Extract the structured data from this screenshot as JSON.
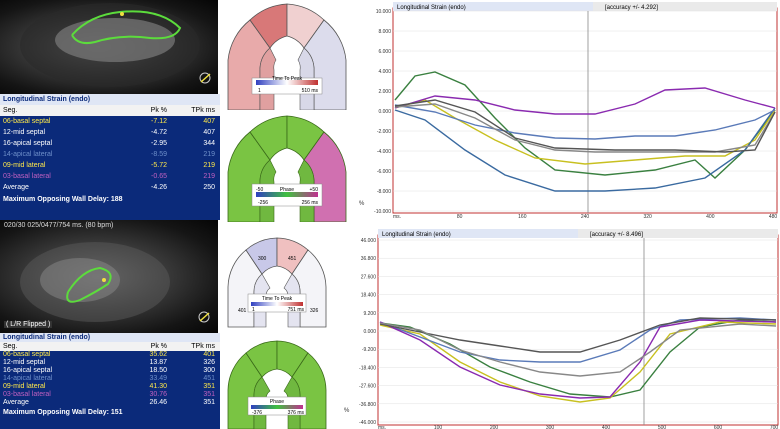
{
  "top": {
    "table": {
      "title": "Longitudinal Strain (endo)",
      "headers": [
        "Seg.",
        "Pk %",
        "TPk ms"
      ],
      "rows": [
        {
          "seg": "06-basal septal",
          "pk": "-7.12",
          "tpk": "407",
          "color": "#ffe94a"
        },
        {
          "seg": "12-mid septal",
          "pk": "-4.72",
          "tpk": "407",
          "color": "#ffffff"
        },
        {
          "seg": "16-apical septal",
          "pk": "-2.95",
          "tpk": "344",
          "color": "#ffffff"
        },
        {
          "seg": "14-apical lateral",
          "pk": "-8.59",
          "tpk": "219",
          "color": "#6e8fc9"
        },
        {
          "seg": "09-mid lateral",
          "pk": "-5.72",
          "tpk": "219",
          "color": "#ffe94a"
        },
        {
          "seg": "03-basal lateral",
          "pk": "-0.65",
          "tpk": "219",
          "color": "#c060c0"
        },
        {
          "seg": "Average",
          "pk": "-4.26",
          "tpk": "250",
          "color": "#ffffff"
        }
      ],
      "footer": "Maximum Opposing Wall Delay: 188"
    },
    "bullseye1": {
      "legend": "Time To Peak",
      "min": "1",
      "max": "510 ms"
    },
    "bullseye2": {
      "legend": "Phase",
      "left": "-50",
      "right": "+50",
      "min": "-256",
      "max": "256 ms"
    },
    "chart": {
      "title": "Longitudinal Strain (endo)",
      "accuracy": "[accuracy +/- 4.292]",
      "yticks": [
        "10.000",
        "8.000",
        "6.000",
        "4.000",
        "2.000",
        "0.000",
        "-2.000",
        "-4.000",
        "-6.000",
        "-8.000",
        "-10.000"
      ],
      "xticks": [
        "ms.",
        "80",
        "160",
        "240",
        "320",
        "400",
        "480"
      ],
      "ylabel": "%"
    }
  },
  "bottom": {
    "mri_caption": "020/30  025/0477/754 ms.  (80 bpm)",
    "mri_tag": "( L/R Flipped )",
    "table": {
      "title": "Longitudinal Strain (endo)",
      "headers": [
        "Seg.",
        "Pk %",
        "TPk ms"
      ],
      "rows": [
        {
          "seg": "06-basal septal",
          "pk": "35.62",
          "tpk": "401",
          "color": "#ffe94a",
          "bg": "#e8e060"
        },
        {
          "seg": "12-mid septal",
          "pk": "13.87",
          "tpk": "326",
          "color": "#ffffff"
        },
        {
          "seg": "16-apical septal",
          "pk": "18.50",
          "tpk": "300",
          "color": "#ffffff"
        },
        {
          "seg": "14-apical lateral",
          "pk": "33.49",
          "tpk": "451",
          "color": "#6e8fc9"
        },
        {
          "seg": "09-mid lateral",
          "pk": "41.30",
          "tpk": "351",
          "color": "#ffe94a"
        },
        {
          "seg": "03-basal lateral",
          "pk": "30.76",
          "tpk": "351",
          "color": "#c060c0"
        },
        {
          "seg": "Average",
          "pk": "26.46",
          "tpk": "351",
          "color": "#ffffff"
        }
      ],
      "footer": "Maximum Opposing Wall Delay: 151"
    },
    "bullseye1": {
      "legend": "Time To Peak",
      "min": "1",
      "max": "751 ms",
      "labels": [
        "401",
        "300",
        "451",
        "326",
        "351",
        "351"
      ]
    },
    "bullseye2": {
      "legend": "Phase",
      "min": "-376",
      "max": "376 ms"
    },
    "chart": {
      "title": "Longitudinal Strain (endo)",
      "accuracy": "[accuracy +/- 8.496]",
      "yticks": [
        "46.000",
        "36.800",
        "27.600",
        "18.400",
        "9.200",
        "0.000",
        "-9.200",
        "-18.400",
        "-27.600",
        "-36.800",
        "-46.000"
      ],
      "xticks": [
        "ms.",
        "100",
        "200",
        "300",
        "400",
        "500",
        "600",
        "700"
      ],
      "ylabel": "%"
    }
  }
}
